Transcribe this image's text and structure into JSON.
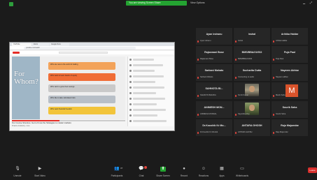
{
  "topbar": {
    "share_banner": "You are viewing Screen Share",
    "view_options": "View Options",
    "right_icons": [
      "minimize-icon",
      "fullscreen-icon"
    ]
  },
  "shared_screen": {
    "browser_tabs": [
      "YouTube",
      "Zoom",
      "Google Docs"
    ],
    "url": "youtube.com/watch",
    "video": {
      "left_text": "For Whom?",
      "bands": [
        {
          "color": "#f3a35a",
          "text": "Who are new to the world of trading"
        },
        {
          "color": "#f06d36",
          "text": "Who want to learn basics of equity"
        },
        {
          "color": "#c9c9c9",
          "text": "Who wish to grow their savings"
        },
        {
          "color": "#b8bfc7",
          "text": "Who like to take calculated risks"
        },
        {
          "color": "#f2c43a",
          "text": "Who want financial freedom"
        }
      ],
      "progress": 0.42,
      "title": "Our Course Structure: Get to Know the Strategies to master markets",
      "meta": "Finance Academy • Live"
    }
  },
  "participants": [
    {
      "name": "Ayan Indranu",
      "sub": "Ayan Indranu"
    },
    {
      "name": "Inshal",
      "sub": "Inshal"
    },
    {
      "name": "Arihika Haldar",
      "sub": "Arihika Haldar"
    },
    {
      "name": "Rajasmani Bose",
      "sub": "Rajasmani Bose"
    },
    {
      "name": "BMS/BBA/21/002",
      "sub": "BMS/BBA/21/002"
    },
    {
      "name": "Puja Paul",
      "sub": "Puja Paul"
    },
    {
      "name": "Sarbani Mahato",
      "sub": "Sarbani Mahato"
    },
    {
      "name": "Sucharita Dutta",
      "sub": "Connecting to audio"
    },
    {
      "name": "Nayeem Akhtar",
      "sub": "Nayeem akhtar"
    },
    {
      "name": "SAHNOTA BI...",
      "sub": "SAHNOTA BHUNIA"
    },
    {
      "name": "",
      "sub": "Smriti Kumar"
    },
    {
      "name": "",
      "sub": "Manik Saha"
    },
    {
      "name": "ANIMESH MON...",
      "sub": "ANIMESH MONDAL"
    },
    {
      "name": "",
      "sub": "Sayantika Roy"
    },
    {
      "name": "Sourik Saha",
      "sub": "Sourik Saha"
    },
    {
      "name": "Dr.Koushik Kr Mo...",
      "sub": "Dr.Koushik Kr Mondal"
    },
    {
      "name": "ANTARA GHOSH",
      "sub": "ANTARA GHOSH"
    },
    {
      "name": "Raju Majumdar",
      "sub": "Raju Majumdar"
    }
  ],
  "avatar_letter": "M",
  "toolbar": {
    "items": [
      {
        "label": "Unmute",
        "icon": "mic-icon"
      },
      {
        "label": "Start Video",
        "icon": "video-icon"
      },
      {
        "label": "Participants",
        "icon": "participants-icon"
      },
      {
        "label": "Chat",
        "icon": "chat-icon"
      },
      {
        "label": "Share Screen",
        "icon": "share-screen-icon"
      },
      {
        "label": "Record",
        "icon": "record-icon"
      },
      {
        "label": "Reactions",
        "icon": "reactions-icon"
      },
      {
        "label": "Apps",
        "icon": "apps-icon"
      },
      {
        "label": "Whiteboards",
        "icon": "whiteboard-icon"
      }
    ],
    "participant_count": "37",
    "leave": "Leave"
  },
  "colors": {
    "accent_green": "#24a331",
    "danger_red": "#e0443c",
    "tile_bg": "#262626"
  }
}
